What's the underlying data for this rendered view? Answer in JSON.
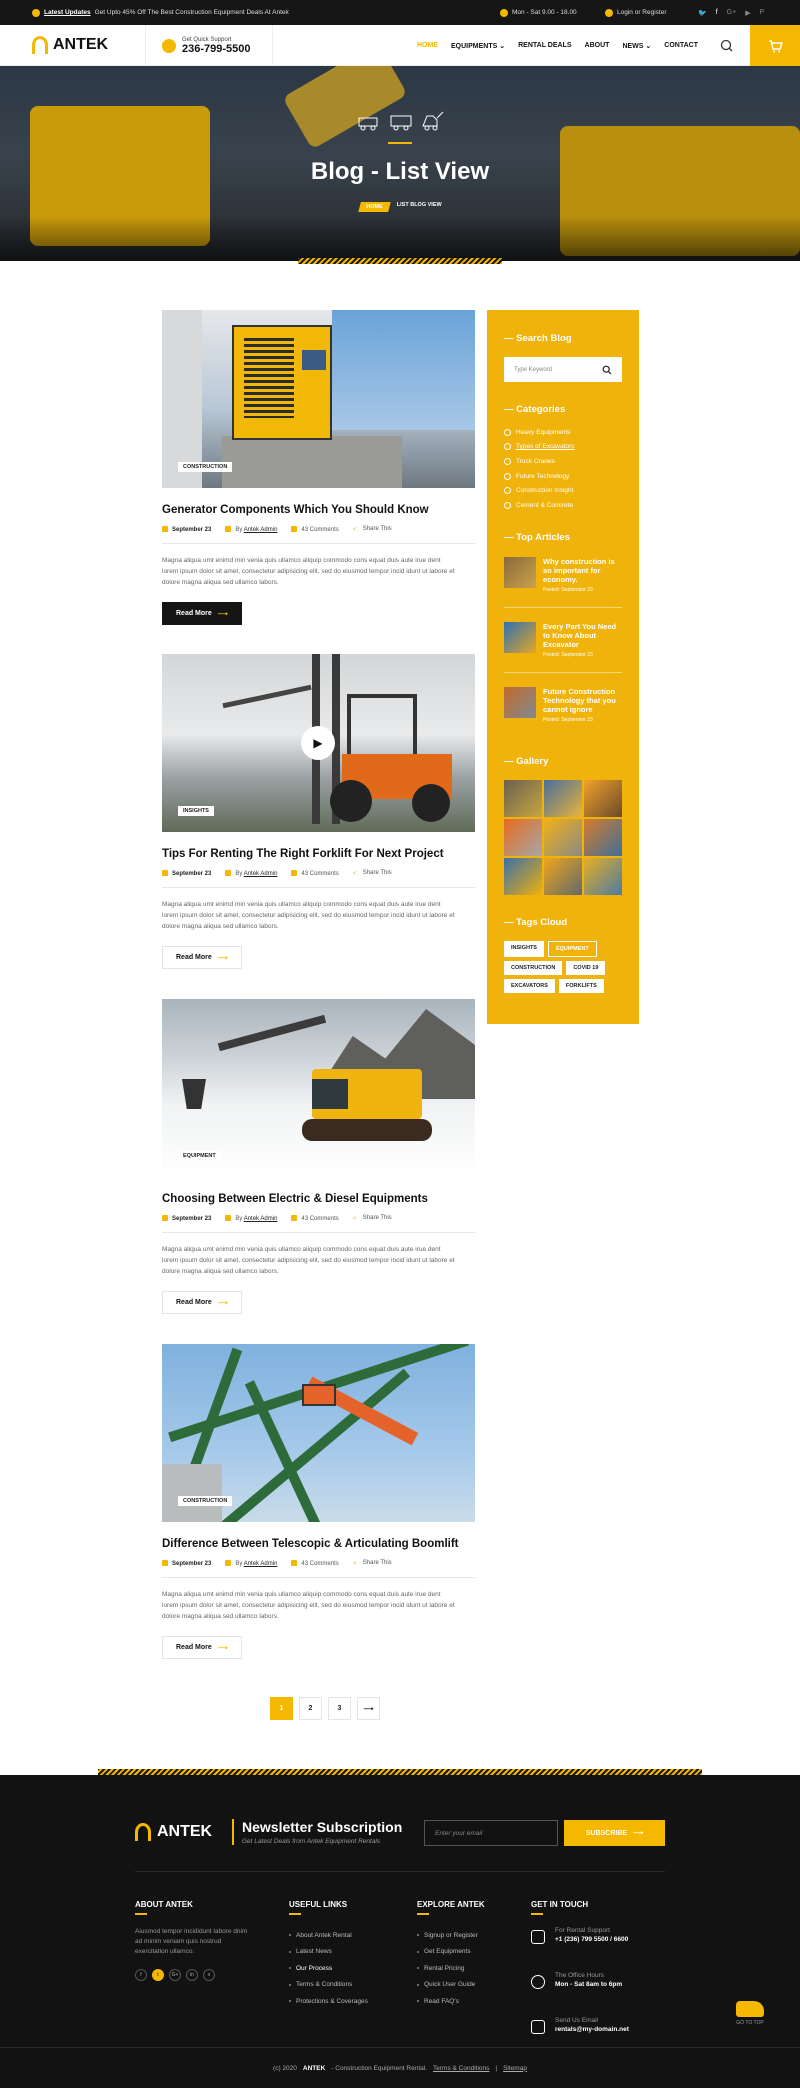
{
  "topbar": {
    "updates_label": "Latest Updates",
    "updates_text": "Get Upto 45% Off The Best Construction Equipment Deals At Antek",
    "hours": "Mon - Sat 9.00 - 18.00",
    "login": "Login or Register",
    "socials": [
      "twitter-icon",
      "facebook-icon",
      "google-plus-icon",
      "youtube-icon",
      "pinterest-icon"
    ]
  },
  "header": {
    "logo": "ANTEK",
    "support_label": "Get Quick Support",
    "support_phone": "236-799-5500",
    "nav": [
      "HOME",
      "EQUIPMENTS",
      "RENTAL DEALS",
      "ABOUT",
      "NEWS",
      "CONTACT"
    ]
  },
  "hero": {
    "title": "Blog - List View",
    "crumb_home": "HOME",
    "crumb_current": "LIST BLOG VIEW"
  },
  "posts": [
    {
      "category": "CONSTRUCTION",
      "title": "Generator Components Which You Should Know",
      "date": "September 23",
      "author_prefix": "By",
      "author": "Antek Admin",
      "comments": "43 Comments",
      "share": "Share This",
      "excerpt": "Magna aliqua umt enimd min venia quis ullamco aliquip commodo cons equat duis aute irue dent lorem ipsum dolor sit amet, consectetur adipisicing elit, sed do eiusmod tempor incid idunt ut labore et dolore magna aliqua sed ullamco labors.",
      "read_more": "Read More"
    },
    {
      "category": "INSIGHTS",
      "title": "Tips For Renting The Right Forklift For Next Project",
      "date": "September 23",
      "author_prefix": "By",
      "author": "Antek Admin",
      "comments": "43 Comments",
      "share": "Share This",
      "excerpt": "Magna aliqua umt enimd min venia quis ullamco aliquip commodo cons equat duis aute irue dent lorem ipsum dolor sit amet, consectetur adipisicing elit, sed do eiusmod tempor incid idunt ut labore et dolore magna aliqua sed ullamco labors.",
      "read_more": "Read More"
    },
    {
      "category": "EQUIPMENT",
      "title": "Choosing Between Electric & Diesel Equipments",
      "date": "September 23",
      "author_prefix": "By",
      "author": "Antek Admin",
      "comments": "43 Comments",
      "share": "Share This",
      "excerpt": "Magna aliqua umt enimd min venia quis ullamco aliquip commodo cons equat duis aute irue dent lorem ipsum dolor sit amet, consectetur adipisicing elit, sed do eiusmod tempor incid idunt ut labore et dolore magna aliqua sed ullamco labors.",
      "read_more": "Read More"
    },
    {
      "category": "CONSTRUCTION",
      "title": "Difference Between Telescopic & Articulating Boomlift",
      "date": "September 23",
      "author_prefix": "By",
      "author": "Antek Admin",
      "comments": "43 Comments",
      "share": "Share This",
      "excerpt": "Magna aliqua umt enimd min venia quis ullamco aliquip commodo cons equat duis aute irue dent lorem ipsum dolor sit amet, consectetur adipisicing elit, sed do eiusmod tempor incid idunt ut labore et dolore magna aliqua sed ullamco labors.",
      "read_more": "Read More"
    }
  ],
  "sidebar": {
    "search_title": "Search Blog",
    "search_placeholder": "Type Keyword",
    "categories_title": "Categories",
    "categories": [
      "Heavy Equipments",
      "Types of Excavators",
      "Truck Cranes",
      "Future Technology",
      "Construction Insight",
      "Cement & Concrete"
    ],
    "top_title": "Top Articles",
    "articles": [
      {
        "title": "Why construction is so important for economy.",
        "posted": "Posted: September 23"
      },
      {
        "title": "Every Part You Need to Know About Excavator",
        "posted": "Posted: September 23"
      },
      {
        "title": "Future Construction Technology that you cannot ignore",
        "posted": "Posted: September 23"
      }
    ],
    "gallery_title": "Gallery",
    "tags_title": "Tags Cloud",
    "tags": [
      "INSIGHTS",
      "EQUIPMENT",
      "CONSTRUCTION",
      "COVID 19",
      "EXCAVATORS",
      "FORKLIFTS"
    ]
  },
  "pagination": [
    "1",
    "2",
    "3"
  ],
  "footer": {
    "logo": "ANTEK",
    "newsletter_title": "Newsletter Subscription",
    "newsletter_sub": "Get Latest Deals from Antek Equipment Rentals",
    "email_placeholder": "Enter your email",
    "subscribe": "SUBSCRIBE",
    "about_title": "ABOUT ANTEK",
    "about_text": "Aiusmod tempor incididunt labore dnim ad minim veniam quis nostrud exercitation ullamco.",
    "useful_title": "USEFUL LINKS",
    "useful_links": [
      "About Antek Rental",
      "Latest News",
      "Our Process",
      "Terms & Conditions",
      "Protections & Coverages"
    ],
    "explore_title": "EXPLORE ANTEK",
    "explore_links": [
      "Signup or Register",
      "Get Equipments",
      "Rental Pricing",
      "Quick User Guide",
      "Read FAQ's"
    ],
    "touch_title": "GET IN TOUCH",
    "contacts": [
      {
        "label": "For Rental Support",
        "value": "+1 (236) 799 5500 / 6600"
      },
      {
        "label": "The Office Hours",
        "value": "Mon - Sat 8am to 6pm"
      },
      {
        "label": "Send Us Email",
        "value": "rentals@my-domain.net"
      }
    ],
    "go_top": "GO TO TOP",
    "copyright_pre": "(c) 2020",
    "copyright_brand": "ANTEK",
    "copyright_post": "- Construction Equipment Rental.",
    "terms": "Terms & Conditions",
    "sitemap": "Sitemap"
  }
}
